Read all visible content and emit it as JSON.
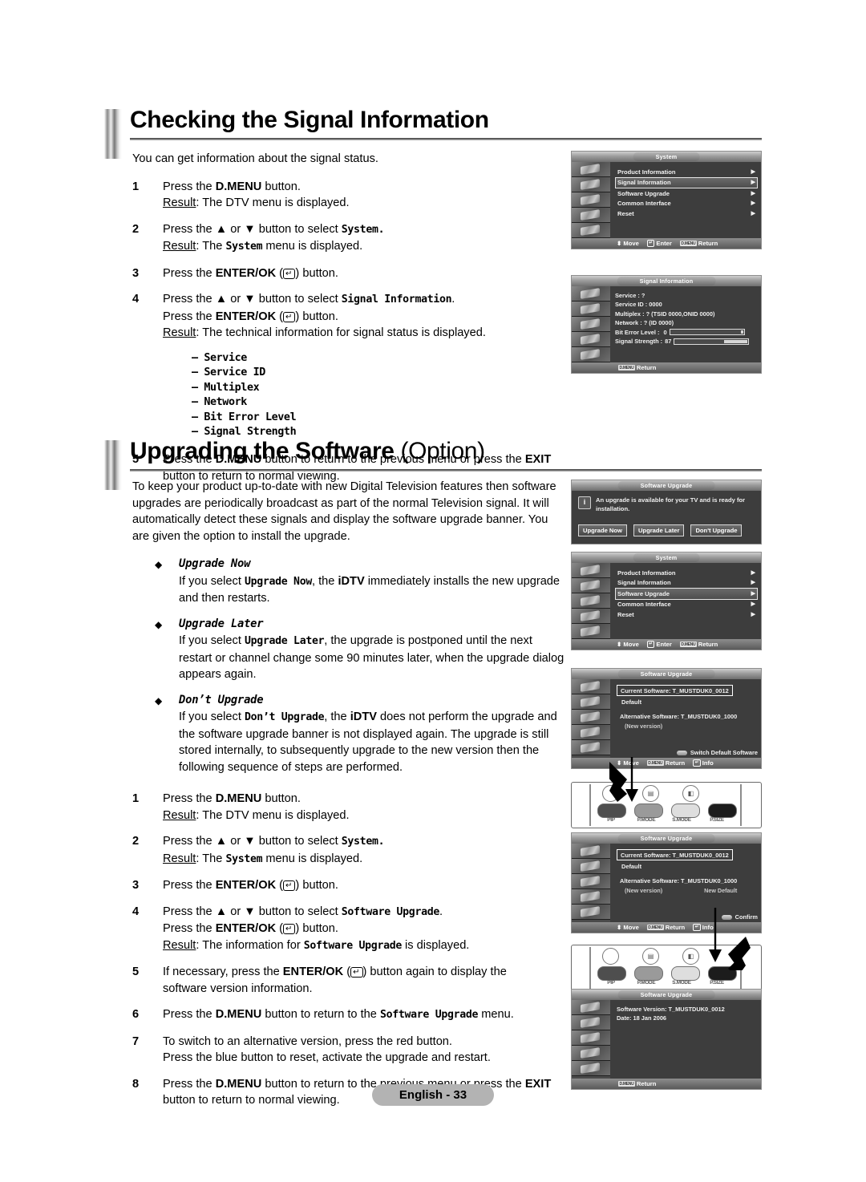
{
  "document": {
    "footer_page": "English - 33"
  },
  "section1": {
    "heading": "Checking the Signal Information",
    "intro": "You can get information about the signal status.",
    "steps": [
      {
        "num": "1",
        "lines": [
          {
            "pre": "Press the ",
            "b": "D.MENU",
            "post": " button."
          },
          {
            "result": "Result",
            "text": ": The DTV menu is displayed."
          }
        ]
      },
      {
        "num": "2",
        "lines": [
          {
            "pre": "Press the ▲ or ▼ button to select ",
            "mono": "System.",
            "post": ""
          },
          {
            "result": "Result",
            "text": ": The ",
            "mono": "System",
            "tail": " menu is displayed."
          }
        ]
      },
      {
        "num": "3",
        "lines": [
          {
            "pre": "Press the ",
            "b": "ENTER/OK",
            "key": "↵",
            "post": " button."
          }
        ]
      },
      {
        "num": "4",
        "lines": [
          {
            "pre": "Press the ▲ or ▼ button to select ",
            "mono": "Signal Information",
            "post": "."
          },
          {
            "pre2": "Press the ",
            "b": "ENTER/OK",
            "key": "↵",
            "post2": " button."
          },
          {
            "result": "Result",
            "text": ": The technical information for signal status is displayed."
          }
        ]
      }
    ],
    "field_list": [
      "– Service",
      "– Service ID",
      "– Multiplex",
      "– Network",
      "– Bit Error Level",
      "– Signal Strength"
    ],
    "step5": {
      "num": "5",
      "pre": "Press the ",
      "b1": "D.MENU",
      "mid": " button to return to the previous menu or press the ",
      "b2": "EXIT",
      "post": "",
      "line2": "button to return to normal viewing."
    }
  },
  "section2": {
    "heading_main": "Upgrading the Software",
    "heading_opt": " (Option)",
    "intro": "To keep your product up-to-date with new Digital Television features then software upgrades are periodically broadcast as part of the normal Television signal. It will automatically detect these signals and display the software upgrade banner. You are given the option to install the upgrade.",
    "bullets": [
      {
        "title": "Upgrade Now",
        "pre": "If you select ",
        "mono": "Upgrade Now",
        "mid": ", the ",
        "b": "iDTV",
        "post": " immediately installs the new upgrade and then restarts."
      },
      {
        "title": "Upgrade Later",
        "pre": "If you select ",
        "mono": "Upgrade Later",
        "mid": ", the upgrade is postponed until the next restart or channel change some 90 minutes later, when the upgrade dialog appears again.",
        "b": "",
        "post": ""
      },
      {
        "title": "Don’t Upgrade",
        "pre": "If you select ",
        "mono": "Don’t Upgrade",
        "mid": ", the ",
        "b": "iDTV",
        "post": " does not perform the upgrade and the software upgrade banner is not displayed again. The upgrade is still stored internally, to subsequently upgrade to the new version then the following sequence of steps are performed."
      }
    ],
    "steps": [
      {
        "num": "1",
        "l1_pre": "Press the ",
        "l1_b": "D.MENU",
        "l1_post": " button.",
        "l2_result": "Result",
        "l2_text": ": The DTV menu is displayed."
      },
      {
        "num": "2",
        "l1_pre": "Press the ▲ or ▼ button to select ",
        "l1_mono": "System.",
        "l1_post": "",
        "l2_result": "Result",
        "l2_text": ": The ",
        "l2_mono": "System",
        "l2_tail": " menu is displayed."
      },
      {
        "num": "3",
        "l1_pre": "Press the ",
        "l1_b": "ENTER/OK",
        "l1_key": "↵",
        "l1_post": " button."
      },
      {
        "num": "4",
        "l1_pre": "Press the ▲ or ▼ button to select ",
        "l1_mono": "Software Upgrade",
        "l1_post": ".",
        "l2_pre": "Press the ",
        "l2_b": "ENTER/OK",
        "l2_key": "↵",
        "l2_post": " button.",
        "l3_result": "Result",
        "l3_text": ": The information for ",
        "l3_mono": "Software Upgrade",
        "l3_tail": " is displayed."
      },
      {
        "num": "5",
        "l1_pre": "If necessary, press the ",
        "l1_b": "ENTER/OK",
        "l1_key": "↵",
        "l1_post": " button again to display the",
        "l2_text": "software version information."
      },
      {
        "num": "6",
        "l1_pre": "Press the ",
        "l1_b": "D.MENU",
        "l1_mid": " button to return to the ",
        "l1_mono": "Software Upgrade",
        "l1_post": " menu."
      },
      {
        "num": "7",
        "l1_text": "To switch to an alternative version, press the red button.",
        "l2_text": "Press the blue button to reset, activate the upgrade and restart."
      },
      {
        "num": "8",
        "l1_pre": "Press the ",
        "l1_b": "D.MENU",
        "l1_mid": " button to return to the previous menu or press the ",
        "l1_b2": "EXIT",
        "l2_text": "button to return to normal viewing."
      }
    ]
  },
  "osd": {
    "system_menu_1": {
      "title": "System",
      "items": [
        {
          "label": "Product Information",
          "selected": false
        },
        {
          "label": "Signal Information",
          "selected": true
        },
        {
          "label": "Software Upgrade",
          "selected": false
        },
        {
          "label": "Common Interface",
          "selected": false
        },
        {
          "label": "Reset",
          "selected": false
        }
      ],
      "footer": [
        {
          "key": "↕",
          "label": "Move"
        },
        {
          "key": "↵",
          "label": "Enter"
        },
        {
          "key": "D.MENU",
          "label": "Return"
        }
      ]
    },
    "signal_information": {
      "title": "Signal Information",
      "lines": [
        "Service : ?",
        "Service ID : 0000",
        "Multiplex : ? (TSID 0000,ONID 0000)",
        "Network : ? (ID 0000)"
      ],
      "bit_error_label": "Bit Error Level :",
      "bit_error_value": "0",
      "bit_error_pct": 3,
      "signal_strength_label": "Signal Strength :",
      "signal_strength_value": "87",
      "signal_strength_pct": 32,
      "footer": [
        {
          "key": "D.MENU",
          "label": "Return"
        }
      ]
    },
    "upgrade_banner": {
      "title": "Software Upgrade",
      "icon": "info-icon",
      "message": "An upgrade is available for your TV and is ready for installation.",
      "buttons": [
        "Upgrade Now",
        "Upgrade Later",
        "Don't Upgrade"
      ]
    },
    "system_menu_2": {
      "title": "System",
      "items": [
        {
          "label": "Product Information",
          "selected": false
        },
        {
          "label": "Signal Information",
          "selected": false
        },
        {
          "label": "Software Upgrade",
          "selected": true
        },
        {
          "label": "Common Interface",
          "selected": false
        },
        {
          "label": "Reset",
          "selected": false
        }
      ],
      "footer": [
        {
          "key": "↕",
          "label": "Move"
        },
        {
          "key": "↵",
          "label": "Enter"
        },
        {
          "key": "D.MENU",
          "label": "Return"
        }
      ]
    },
    "software_upgrade_1": {
      "title": "Software Upgrade",
      "current_software": "Current Software: T_MUSTDUK0_0012",
      "current_sub": "Default",
      "alternative_software": "Alternative Software: T_MUSTDUK0_1000",
      "alternative_sub": "(New version)",
      "alternative_sub2": "",
      "action_label": "Switch Default Software",
      "footer": [
        {
          "key": "↕",
          "label": "Move"
        },
        {
          "key": "D.MENU",
          "label": "Return"
        },
        {
          "key": "↵",
          "label": "Info"
        }
      ]
    },
    "software_upgrade_2": {
      "title": "Software Upgrade",
      "current_software": "Current Software: T_MUSTDUK0_0012",
      "current_sub": "Default",
      "alternative_software": "Alternative Software: T_MUSTDUK0_1000",
      "alternative_sub": "(New version)",
      "alternative_sub2": "New Default",
      "action_label": "Confirm",
      "footer": [
        {
          "key": "↕",
          "label": "Move"
        },
        {
          "key": "D.MENU",
          "label": "Return"
        },
        {
          "key": "↵",
          "label": "Info"
        }
      ]
    },
    "software_version": {
      "title": "Software Upgrade",
      "line1": "Software Version: T_MUSTDUK0_0012",
      "line2": "Date: 18 Jan 2006",
      "footer": [
        {
          "key": "D.MENU",
          "label": "Return"
        }
      ]
    }
  },
  "remote": {
    "button_labels": [
      "PIP",
      "P.MODE",
      "S.MODE",
      "P.SIZE"
    ],
    "highlight_first": "PIP",
    "highlight_second": "P.SIZE"
  }
}
